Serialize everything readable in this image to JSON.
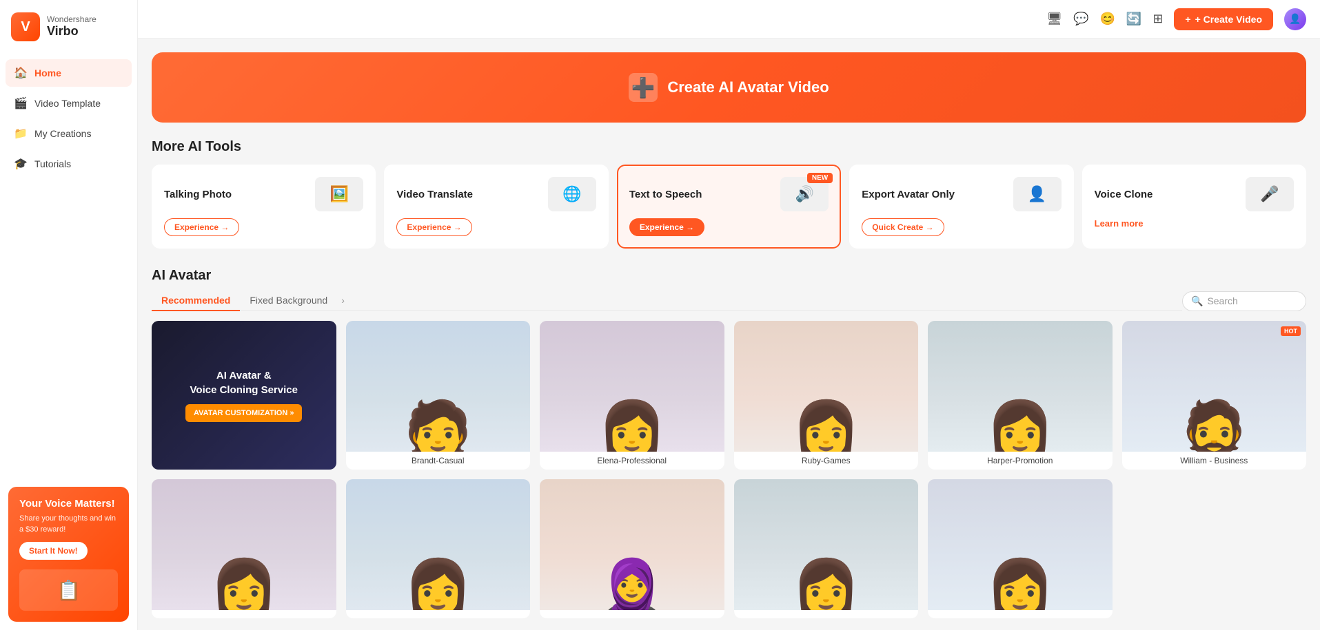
{
  "app": {
    "brand": "Wondershare",
    "product": "Virbo"
  },
  "sidebar": {
    "nav_items": [
      {
        "id": "home",
        "label": "Home",
        "icon": "🏠",
        "active": true
      },
      {
        "id": "video-template",
        "label": "Video Template",
        "icon": "🎬",
        "active": false
      },
      {
        "id": "my-creations",
        "label": "My Creations",
        "icon": "🎓",
        "active": false
      },
      {
        "id": "tutorials",
        "label": "Tutorials",
        "icon": "🎓",
        "active": false
      }
    ],
    "promo": {
      "title": "Your Voice Matters!",
      "subtitle": "Share your thoughts and win a $30 reward!",
      "button": "Start It Now!"
    }
  },
  "topbar": {
    "create_button": "+ Create Video",
    "icons": [
      "monitor",
      "message",
      "emoji",
      "refresh",
      "grid"
    ]
  },
  "hero": {
    "title": "Create AI Avatar Video",
    "icon": "➕"
  },
  "more_ai_tools": {
    "section_title": "More AI Tools",
    "tools": [
      {
        "id": "talking-photo",
        "name": "Talking Photo",
        "button_label": "Experience →",
        "highlighted": false,
        "new": false,
        "learn": false
      },
      {
        "id": "video-translate",
        "name": "Video Translate",
        "button_label": "Experience →",
        "highlighted": false,
        "new": false,
        "learn": false
      },
      {
        "id": "text-to-speech",
        "name": "Text to Speech",
        "button_label": "Experience →",
        "highlighted": true,
        "new": true,
        "new_badge": "NEW",
        "learn": false
      },
      {
        "id": "export-avatar",
        "name": "Export Avatar Only",
        "button_label": "Quick Create →",
        "highlighted": false,
        "new": false,
        "learn": false
      },
      {
        "id": "voice-clone",
        "name": "Voice Clone",
        "button_label": "Learn more",
        "highlighted": false,
        "new": false,
        "learn": true
      }
    ]
  },
  "ai_avatar": {
    "section_title": "AI Avatar",
    "tabs": [
      {
        "id": "recommended",
        "label": "Recommended",
        "active": true
      },
      {
        "id": "fixed-background",
        "label": "Fixed Background",
        "active": false
      }
    ],
    "search_placeholder": "Search",
    "promo_card": {
      "title": "AI Avatar & Voice Cloning Service",
      "button": "AVATAR CUSTOMIZATION »"
    },
    "avatars": [
      {
        "id": "brandt",
        "name": "Brandt-Casual",
        "hot": false,
        "bg": "av1"
      },
      {
        "id": "elena",
        "name": "Elena-Professional",
        "hot": false,
        "bg": "av2"
      },
      {
        "id": "ruby",
        "name": "Ruby-Games",
        "hot": false,
        "bg": "av3"
      },
      {
        "id": "harper",
        "name": "Harper-Promotion",
        "hot": false,
        "bg": "av4"
      },
      {
        "id": "william",
        "name": "William - Business",
        "hot": true,
        "bg": "av5"
      }
    ],
    "avatars_row2": [
      {
        "id": "av6",
        "name": "",
        "bg": "av2"
      },
      {
        "id": "av7",
        "name": "",
        "bg": "av1"
      },
      {
        "id": "av8",
        "name": "",
        "bg": "av3"
      },
      {
        "id": "av9",
        "name": "",
        "bg": "av4"
      },
      {
        "id": "av10",
        "name": "",
        "bg": "av5"
      }
    ]
  }
}
